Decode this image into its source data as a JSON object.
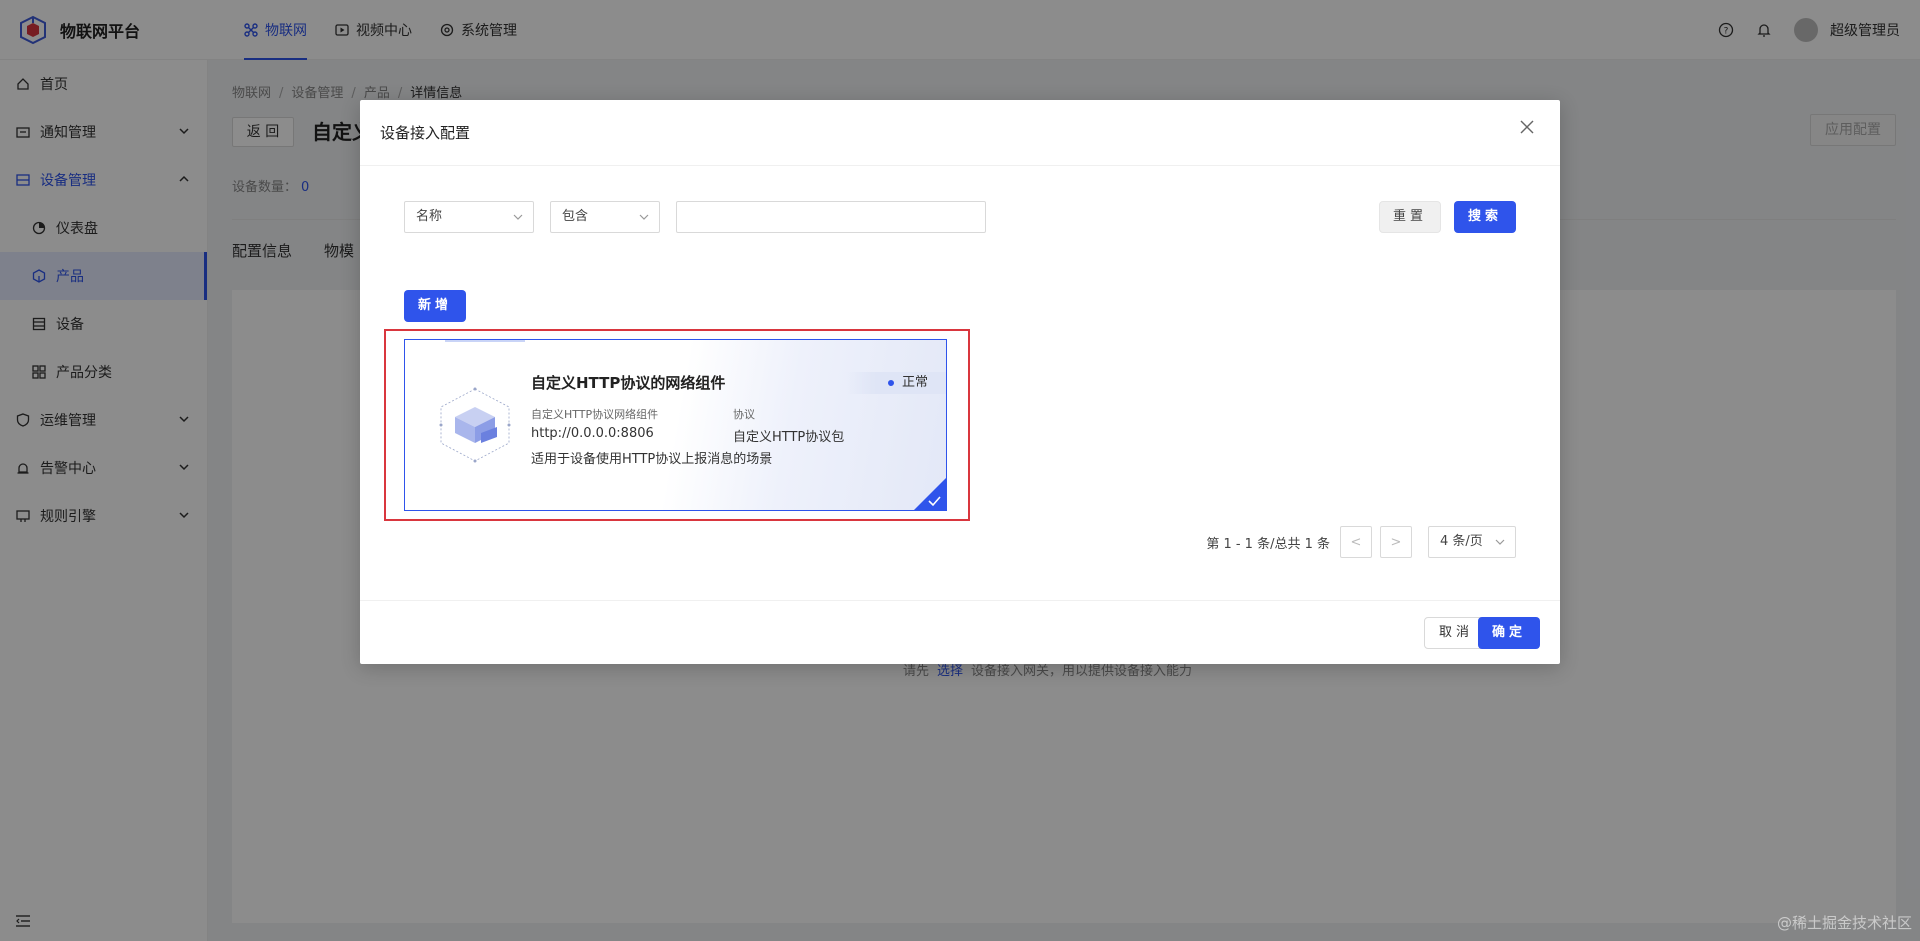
{
  "app": {
    "title": "物联网平台"
  },
  "topnav": [
    {
      "label": "物联网",
      "icon": "iot-icon",
      "active": true
    },
    {
      "label": "视频中心",
      "icon": "video-icon"
    },
    {
      "label": "系统管理",
      "icon": "settings-icon"
    }
  ],
  "user": {
    "name": "超级管理员"
  },
  "sidebar": {
    "items": [
      {
        "label": "首页"
      },
      {
        "label": "通知管理"
      },
      {
        "label": "设备管理"
      },
      {
        "label": "仪表盘"
      },
      {
        "label": "产品"
      },
      {
        "label": "设备"
      },
      {
        "label": "产品分类"
      },
      {
        "label": "运维管理"
      },
      {
        "label": "告警中心"
      },
      {
        "label": "规则引擎"
      }
    ]
  },
  "page": {
    "breadcrumb": [
      "物联网",
      "设备管理",
      "产品",
      "详情信息"
    ],
    "back_label": "返 回",
    "title": "自定义",
    "apply_label": "应用配置",
    "device_count_label": "设备数量：",
    "device_count": "0",
    "tabs": [
      "配置信息",
      "物模"
    ],
    "empty_hint_pre": "请先",
    "empty_hint_link": "选择",
    "empty_hint_post": "设备接入网关，用以提供设备接入能力"
  },
  "modal": {
    "title": "设备接入配置",
    "filter_field": "名称",
    "filter_op": "包含",
    "search_value": "",
    "reset_label": "重置",
    "search_label": "搜索",
    "add_label": "新增",
    "card": {
      "title": "自定义HTTP协议的网络组件",
      "status": "正常",
      "k1": "自定义HTTP协议网络组件",
      "v1": "http://0.0.0.0:8806",
      "k2": "协议",
      "v2": "自定义HTTP协议包",
      "desc": "适用于设备使用HTTP协议上报消息的场景"
    },
    "pager": {
      "info": "第 1 - 1 条/总共 1 条",
      "prev": "<",
      "next": ">",
      "size": "4 条/页"
    },
    "cancel_label": "取消",
    "ok_label": "确定"
  },
  "watermark": "@稀土掘金技术社区",
  "colors": {
    "accent": "#2f54eb",
    "highlight": "#d9363e"
  }
}
